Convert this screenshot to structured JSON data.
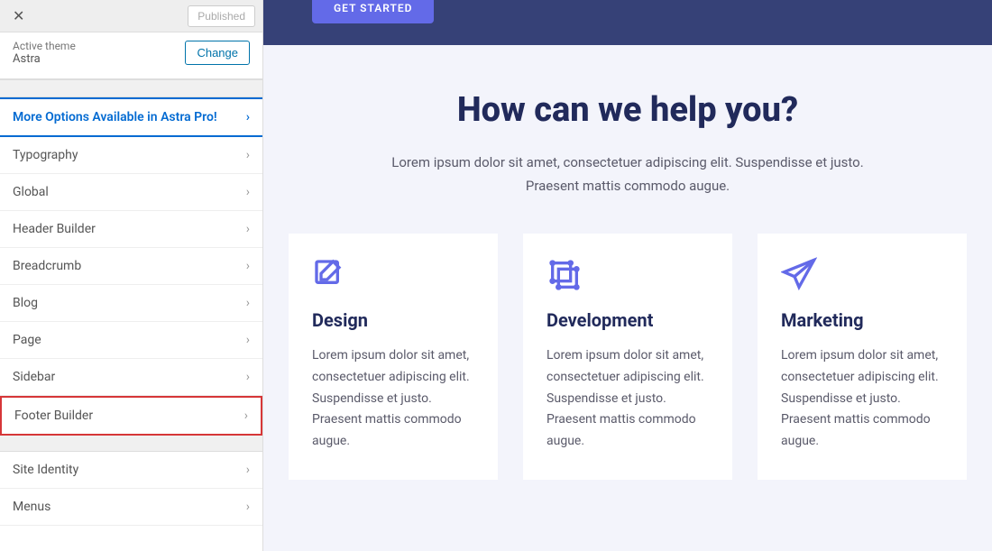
{
  "topbar": {
    "published": "Published"
  },
  "theme": {
    "active_label": "Active theme",
    "name": "Astra",
    "change": "Change"
  },
  "promo": {
    "label": "More Options Available in Astra Pro!"
  },
  "menu": {
    "typography": "Typography",
    "global": "Global",
    "header_builder": "Header Builder",
    "breadcrumb": "Breadcrumb",
    "blog": "Blog",
    "page": "Page",
    "sidebar": "Sidebar",
    "footer_builder": "Footer Builder",
    "site_identity": "Site Identity",
    "menus": "Menus"
  },
  "preview": {
    "cta": "GET STARTED",
    "title": "How can we help you?",
    "subtitle": "Lorem ipsum dolor sit amet, consectetuer adipiscing elit. Suspendisse et justo. Praesent mattis commodo augue.",
    "cards": [
      {
        "title": "Design",
        "text": "Lorem ipsum dolor sit amet, consectetuer adipiscing elit. Suspendisse et justo. Praesent mattis commodo augue."
      },
      {
        "title": "Development",
        "text": "Lorem ipsum dolor sit amet, consectetuer adipiscing elit. Suspendisse et justo. Praesent mattis commodo augue."
      },
      {
        "title": "Marketing",
        "text": "Lorem ipsum dolor sit amet, consectetuer adipiscing elit. Suspendisse et justo. Praesent mattis commodo augue."
      }
    ]
  }
}
